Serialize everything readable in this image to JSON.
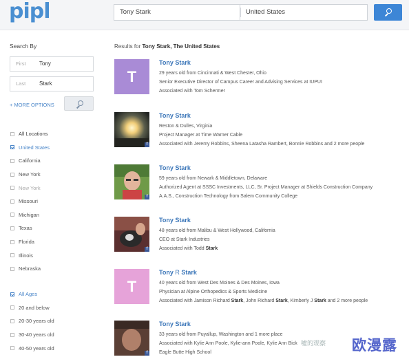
{
  "logo": "pipl",
  "search": {
    "name": "Tony Stark",
    "location": "United States"
  },
  "sidebar": {
    "title": "Search By",
    "first_label": "First",
    "first_value": "Tony",
    "last_label": "Last",
    "last_value": "Stark",
    "more_options": "+ MORE OPTIONS",
    "locations": [
      {
        "label": "All Locations",
        "checked": false
      },
      {
        "label": "United States",
        "checked": true
      },
      {
        "label": "California",
        "checked": false
      },
      {
        "label": "New York",
        "checked": false
      },
      {
        "label": "New York",
        "checked": false
      },
      {
        "label": "Missouri",
        "checked": false
      },
      {
        "label": "Michigan",
        "checked": false
      },
      {
        "label": "Texas",
        "checked": false
      },
      {
        "label": "Florida",
        "checked": false
      },
      {
        "label": "Illinois",
        "checked": false
      },
      {
        "label": "Nebraska",
        "checked": false
      }
    ],
    "ages": [
      {
        "label": "All Ages",
        "checked": true
      },
      {
        "label": "20 and below",
        "checked": false
      },
      {
        "label": "20-30 years old",
        "checked": false
      },
      {
        "label": "30-40 years old",
        "checked": false
      },
      {
        "label": "40-50 years old",
        "checked": false
      }
    ]
  },
  "results_head": {
    "prefix": "Results for",
    "query": "Tony Stark, The United States"
  },
  "results": [
    {
      "name_first": "Tony",
      "name_mid": "",
      "name_last": "Stark",
      "avatar_letter": "T",
      "avatar_color": "#a98bd6",
      "lines": [
        "29 years old from Cincinnati & West Chester, Ohio",
        "Senior Executive Director of Campus Career and Advising Services at IUPUI",
        "Associated with Tom Schermer"
      ]
    },
    {
      "name_first": "Tony",
      "name_mid": "",
      "name_last": "Stark",
      "avatar_letter": "",
      "avatar_color": "#3a3a2e",
      "lines": [
        "Reston & Dulles, Virginia",
        "Project Manager at Time Warner Cable",
        "Associated with Jeremy Robbins, Sheena Latasha Rambert, Bonnie Robbins and 2 more people"
      ]
    },
    {
      "name_first": "Tony",
      "name_mid": "",
      "name_last": "Stark",
      "avatar_letter": "",
      "avatar_color": "#7aa34a",
      "lines": [
        "59 years old from Newark & Middletown, Delaware",
        "Authorized Agent at SSSC Investments, LLC, Sr. Project Manager at Shields Construction Company",
        "A.A.S., Construction Technology from Salem Community College"
      ]
    },
    {
      "name_first": "Tony",
      "name_mid": "",
      "name_last": "Stark",
      "avatar_letter": "",
      "avatar_color": "#6b3a3a",
      "lines": [
        "48 years old from Malibu & West Hollywood, California",
        "CEO at Stark Industries",
        "Associated with Todd Stark"
      ]
    },
    {
      "name_first": "Tony",
      "name_mid": "R",
      "name_last": "Stark",
      "avatar_letter": "T",
      "avatar_color": "#e6a3d9",
      "lines": [
        "40 years old from West Des Moines & Des Moines, Iowa",
        "Physician at Alpine Orthopedics & Sports Medicine",
        "Associated with Jamison Richard Stark, John Richard Stark, Kimberly J Stark and 2 more people"
      ]
    },
    {
      "name_first": "Tony",
      "name_mid": "",
      "name_last": "Stark",
      "avatar_letter": "",
      "avatar_color": "#6a4a3a",
      "lines": [
        "33 years old from Puyallup, Washington and 1 more place",
        "Associated with Kylie Ann Poole, Kylie-ann Poole, Kylie Ann Bick",
        "Eagle Butte High School"
      ]
    }
  ],
  "watermark": {
    "small": "嘘的观察",
    "big": "欧漫露"
  },
  "colors": {
    "accent": "#3d86d6",
    "link": "#3a75b8",
    "facebook": "#3b5998"
  }
}
